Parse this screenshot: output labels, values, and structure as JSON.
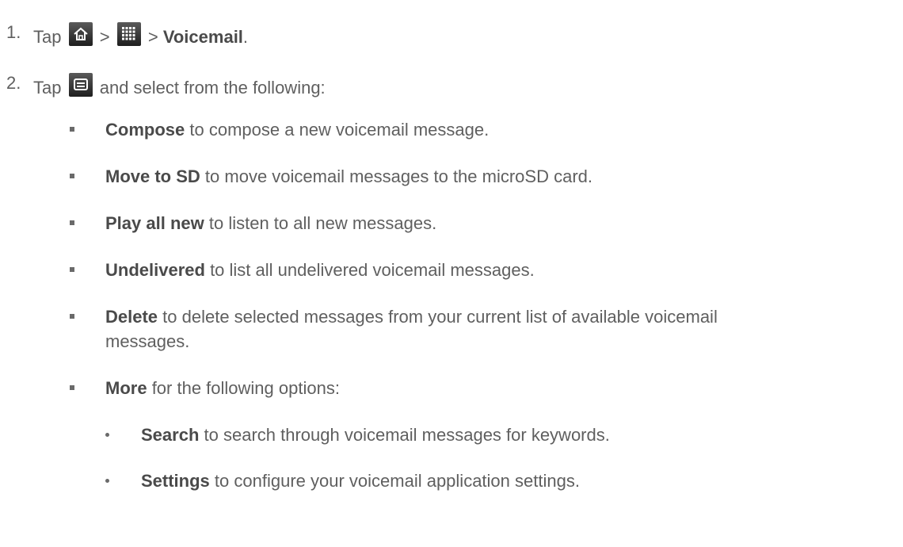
{
  "step1": {
    "number": "1.",
    "tap": "Tap",
    "sep1": ">",
    "sep2": ">",
    "target": "Voicemail",
    "end": ".",
    "icons": [
      "home-icon",
      "apps-grid-icon"
    ]
  },
  "step2": {
    "number": "2.",
    "tap": "Tap",
    "rest": "and select from the following:",
    "icon": "menu-icon"
  },
  "options": [
    {
      "term": "Compose",
      "desc": "to compose a new voicemail message."
    },
    {
      "term": "Move to SD",
      "desc": "to move voicemail messages to the microSD card."
    },
    {
      "term": "Play all new",
      "desc": "to listen to all new messages."
    },
    {
      "term": "Undelivered",
      "desc": "to list all undelivered voicemail messages."
    },
    {
      "term": "Delete",
      "desc": "to delete selected messages from your current list of available voicemail",
      "desc2": "messages."
    },
    {
      "term": "More",
      "desc": "for the following options:"
    }
  ],
  "more_options": [
    {
      "term": "Search",
      "desc": "to search through voicemail messages for keywords."
    },
    {
      "term": "Settings",
      "desc": "to configure your voicemail application settings."
    }
  ]
}
